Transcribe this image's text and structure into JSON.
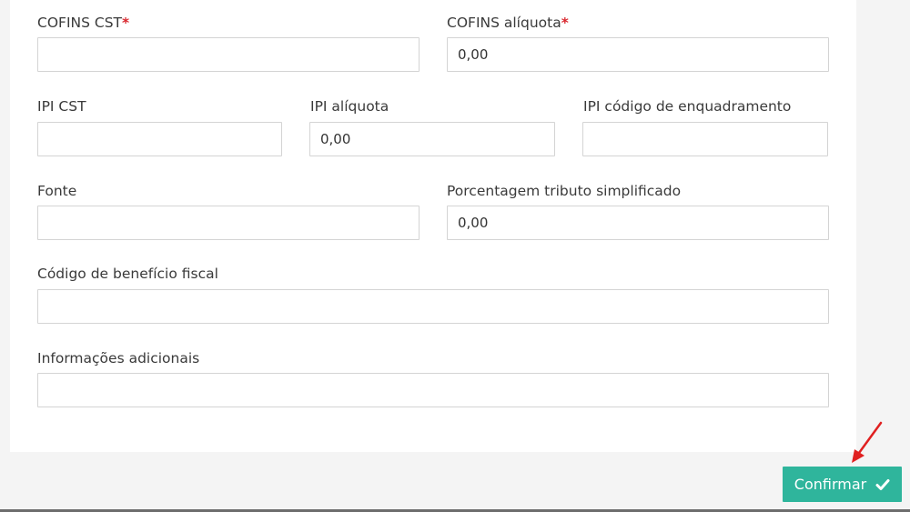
{
  "form": {
    "cofins_cst": {
      "label": "COFINS CST",
      "required_mark": "*",
      "value": ""
    },
    "cofins_aliquota": {
      "label": "COFINS alíquota",
      "required_mark": "*",
      "value": "0,00"
    },
    "ipi_cst": {
      "label": "IPI CST",
      "value": ""
    },
    "ipi_aliquota": {
      "label": "IPI alíquota",
      "value": "0,00"
    },
    "ipi_codigo_enquadramento": {
      "label": "IPI código de enquadramento",
      "value": ""
    },
    "fonte": {
      "label": "Fonte",
      "value": ""
    },
    "porcentagem_tributo": {
      "label": "Porcentagem tributo simplificado",
      "value": "0,00"
    },
    "codigo_beneficio_fiscal": {
      "label": "Código de benefício fiscal",
      "value": ""
    },
    "informacoes_adicionais": {
      "label": "Informações adicionais",
      "value": ""
    }
  },
  "actions": {
    "confirm_label": "Confirmar",
    "confirm_icon": "check-icon"
  },
  "colors": {
    "accent": "#2fb59c",
    "required": "#d9272e",
    "annotation_arrow": "#e02020"
  }
}
